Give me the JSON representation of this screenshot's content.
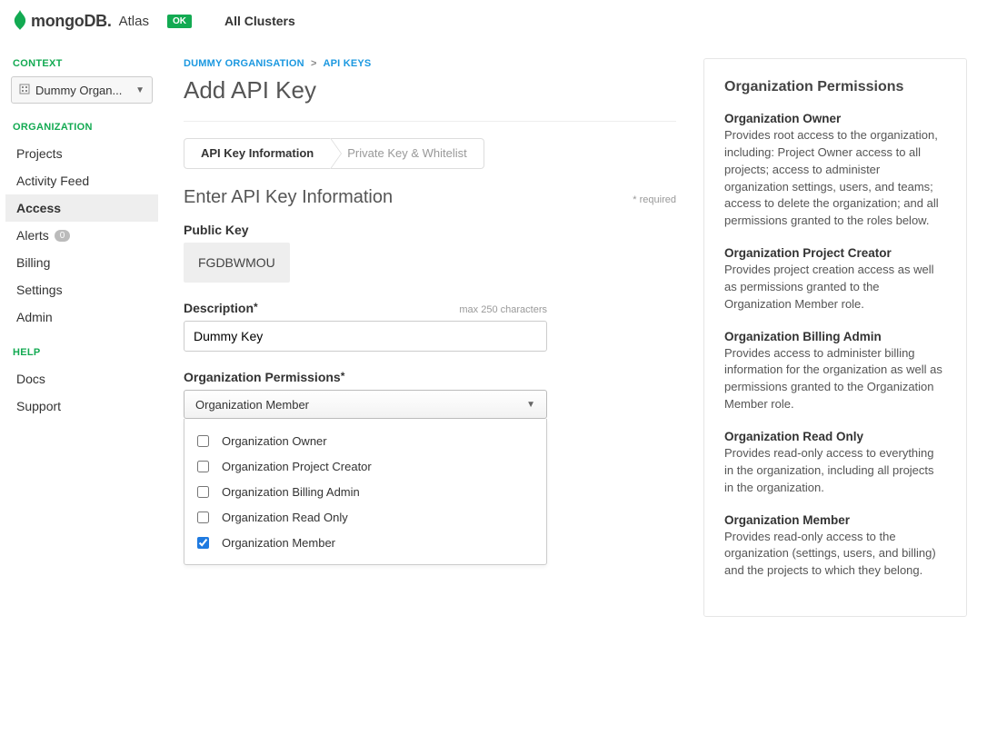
{
  "brand": {
    "name": "mongoDB.",
    "product": "Atlas",
    "badge": "OK"
  },
  "topnav": {
    "all_clusters": "All Clusters"
  },
  "context": {
    "label": "CONTEXT",
    "selected": "Dummy Organ..."
  },
  "sidebar": {
    "org_label": "ORGANIZATION",
    "org_items": [
      {
        "label": "Projects"
      },
      {
        "label": "Activity Feed"
      },
      {
        "label": "Access"
      },
      {
        "label": "Alerts",
        "count": "0"
      },
      {
        "label": "Billing"
      },
      {
        "label": "Settings"
      },
      {
        "label": "Admin"
      }
    ],
    "help_label": "HELP",
    "help_items": [
      {
        "label": "Docs"
      },
      {
        "label": "Support"
      }
    ]
  },
  "crumbs": {
    "org": "DUMMY ORGANISATION",
    "sep": ">",
    "page": "API KEYS"
  },
  "page_title": "Add API Key",
  "steps": {
    "s1": "API Key Information",
    "s2": "Private Key & Whitelist"
  },
  "section": {
    "title": "Enter API Key Information",
    "required": "* required"
  },
  "public_key": {
    "label": "Public Key",
    "value": "FGDBWMOU"
  },
  "description": {
    "label": "Description",
    "hint": "max 250 characters",
    "value": "Dummy Key"
  },
  "org_perms": {
    "label": "Organization Permissions",
    "selected": "Organization Member",
    "options": [
      {
        "label": "Organization Owner",
        "checked": false
      },
      {
        "label": "Organization Project Creator",
        "checked": false
      },
      {
        "label": "Organization Billing Admin",
        "checked": false
      },
      {
        "label": "Organization Read Only",
        "checked": false
      },
      {
        "label": "Organization Member",
        "checked": true
      }
    ]
  },
  "perms_help": {
    "title": "Organization Permissions",
    "items": [
      {
        "title": "Organization Owner",
        "desc": "Provides root access to the organization, including: Project Owner access to all projects; access to administer organization settings, users, and teams; access to delete the organization; and all permissions granted to the roles below."
      },
      {
        "title": "Organization Project Creator",
        "desc": "Provides project creation access as well as permissions granted to the Organization Member role."
      },
      {
        "title": "Organization Billing Admin",
        "desc": "Provides access to administer billing information for the organization as well as permissions granted to the Organization Member role."
      },
      {
        "title": "Organization Read Only",
        "desc": "Provides read-only access to everything in the organization, including all projects in the organization."
      },
      {
        "title": "Organization Member",
        "desc": "Provides read-only access to the organization (settings, users, and billing) and the projects to which they belong."
      }
    ]
  }
}
